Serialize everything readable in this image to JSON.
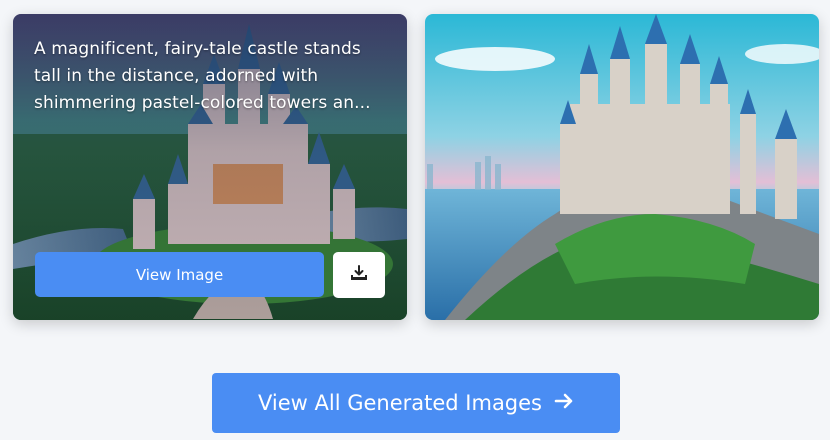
{
  "cards": [
    {
      "prompt": "A magnificent, fairy-tale castle stands tall in the distance, adorned with shimmering pastel-colored towers an...",
      "view_label": "View Image",
      "download_icon": "download-icon"
    },
    {
      "image": "castle-on-cliff"
    }
  ],
  "footer": {
    "view_all_label": "View All Generated Images",
    "arrow_icon": "arrow-right-icon"
  },
  "colors": {
    "accent": "#4a8df3",
    "background": "#f4f6f9"
  }
}
